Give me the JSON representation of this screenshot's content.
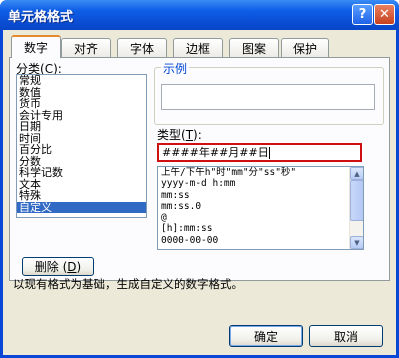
{
  "window": {
    "title": "单元格格式",
    "help_button": "?",
    "close_button": "✕"
  },
  "tabs": [
    {
      "label": "数字",
      "active": true
    },
    {
      "label": "对齐"
    },
    {
      "label": "字体"
    },
    {
      "label": "边框"
    },
    {
      "label": "图案"
    },
    {
      "label": "保护"
    }
  ],
  "category": {
    "label_text": "分类",
    "label_key": "C",
    "items": [
      "常规",
      "数值",
      "货币",
      "会计专用",
      "日期",
      "时间",
      "百分比",
      "分数",
      "科学记数",
      "文本",
      "特殊",
      "自定义"
    ],
    "selected": "自定义"
  },
  "sample": {
    "title": "示例",
    "value": ""
  },
  "type": {
    "label_text": "类型",
    "label_key": "T",
    "input_value": "####年##月##日",
    "formats": [
      "上午/下午h\"时\"mm\"分\"ss\"秒\"",
      "yyyy-m-d h:mm",
      "mm:ss",
      "mm:ss.0",
      "@",
      "[h]:mm:ss",
      "0000-00-00"
    ]
  },
  "delete_button": {
    "label_text": "删除",
    "label_key": "D"
  },
  "hint_text": "以现有格式为基础，生成自定义的数字格式。",
  "buttons": {
    "ok": "确定",
    "cancel": "取消"
  },
  "colors": {
    "titlebar": "#0a4fd6",
    "dialog_bg": "#ece9d8",
    "selection": "#316ac5",
    "highlight_box": "#d01010",
    "group_title": "#0046d5"
  }
}
